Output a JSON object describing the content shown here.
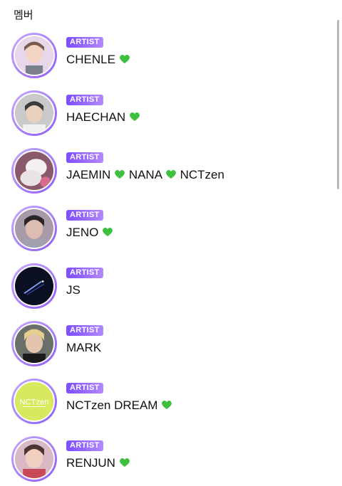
{
  "section_title": "멤버",
  "badge_label": "ARTIST",
  "heart_color": "#3fbf3f",
  "members": [
    {
      "name_parts": [
        "CHENLE"
      ],
      "hearts": 1
    },
    {
      "name_parts": [
        "HAECHAN"
      ],
      "hearts": 1
    },
    {
      "name_parts": [
        "JAEMIN",
        "NANA",
        "NCTzen"
      ],
      "hearts": 2
    },
    {
      "name_parts": [
        "JENO"
      ],
      "hearts": 1
    },
    {
      "name_parts": [
        "JS"
      ],
      "hearts": 0
    },
    {
      "name_parts": [
        "MARK"
      ],
      "hearts": 0
    },
    {
      "name_parts": [
        "NCTzen DREAM"
      ],
      "hearts": 1
    },
    {
      "name_parts": [
        "RENJUN"
      ],
      "hearts": 1
    }
  ],
  "avatar_text": {
    "nctzen": "NCTzen"
  }
}
